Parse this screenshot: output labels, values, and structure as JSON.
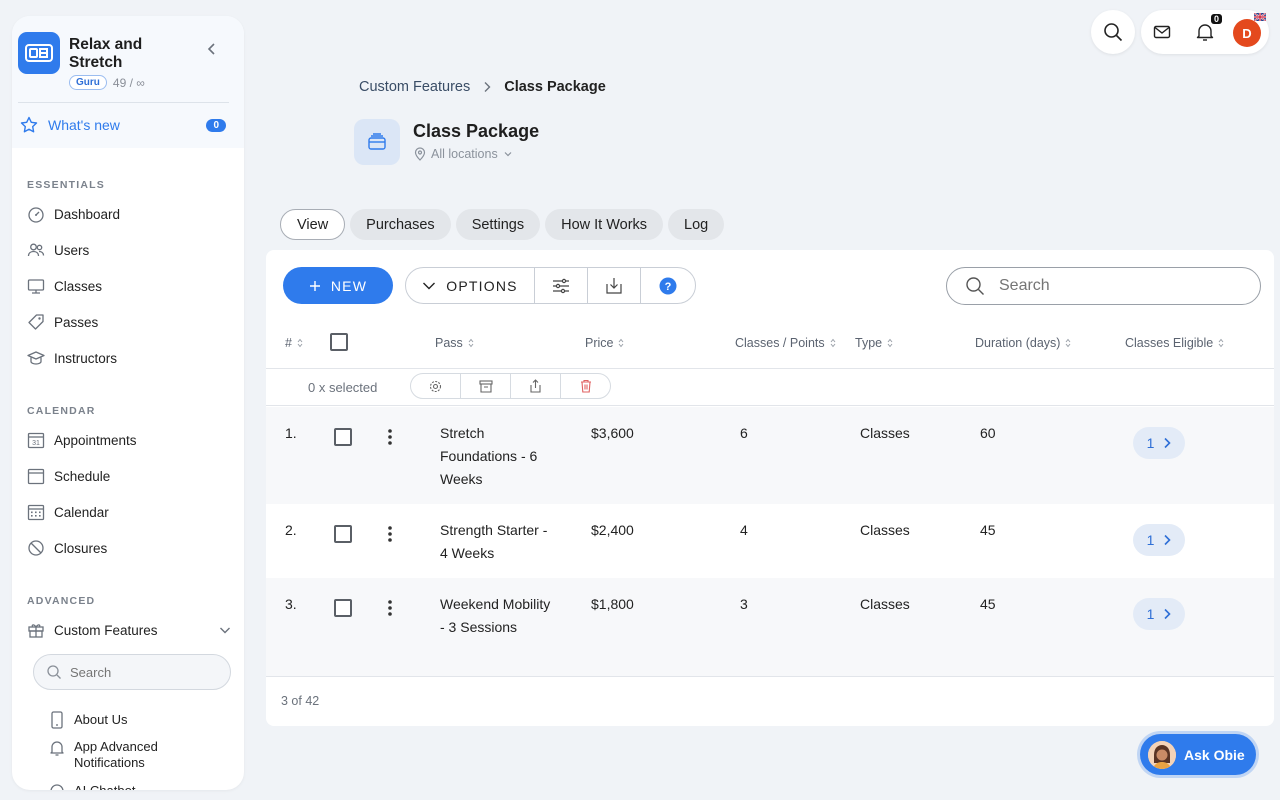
{
  "sidebar": {
    "business_name": "Relax and Stretch",
    "plan_badge": "Guru",
    "plan_count": "49 / ∞",
    "whats_new": {
      "label": "What's new",
      "count": "0"
    },
    "sections": {
      "essentials": "ESSENTIALS",
      "calendar": "CALENDAR",
      "advanced": "ADVANCED"
    },
    "essentials_items": [
      {
        "label": "Dashboard",
        "icon": "dashboard-icon"
      },
      {
        "label": "Users",
        "icon": "users-icon"
      },
      {
        "label": "Classes",
        "icon": "classes-icon"
      },
      {
        "label": "Passes",
        "icon": "passes-icon"
      },
      {
        "label": "Instructors",
        "icon": "instructors-icon"
      }
    ],
    "calendar_items": [
      {
        "label": "Appointments",
        "icon": "appointments-icon"
      },
      {
        "label": "Schedule",
        "icon": "schedule-icon"
      },
      {
        "label": "Calendar",
        "icon": "calendar-icon"
      },
      {
        "label": "Closures",
        "icon": "closures-icon"
      }
    ],
    "advanced_items": [
      {
        "label": "Custom Features",
        "icon": "gift-icon"
      }
    ],
    "search_placeholder": "Search",
    "sub_items": [
      {
        "label": "About Us",
        "icon": "phone-icon"
      },
      {
        "label": "App Advanced Notifications",
        "icon": "bell-icon"
      },
      {
        "label": "AI Chatbot",
        "icon": "chatbot-icon"
      }
    ]
  },
  "topbar": {
    "notification_count": "0",
    "avatar_initial": "D"
  },
  "header": {
    "breadcrumb": [
      "Custom Features",
      "Class Package"
    ],
    "title": "Class Package",
    "location": "All locations"
  },
  "tabs": [
    "View",
    "Purchases",
    "Settings",
    "How It Works",
    "Log"
  ],
  "toolbar": {
    "new_label": "NEW",
    "options_label": "OPTIONS",
    "search_placeholder": "Search"
  },
  "table": {
    "columns": [
      "#",
      "Pass",
      "Price",
      "Classes / Points",
      "Type",
      "Duration (days)",
      "Classes Eligible"
    ],
    "selected_text": "0 x selected",
    "rows": [
      {
        "num": "1.",
        "pass": "Stretch Foundations - 6 Weeks",
        "price": "$3,600",
        "classes": "6",
        "type": "Classes",
        "duration": "60",
        "eligible": "1"
      },
      {
        "num": "2.",
        "pass": "Strength Starter - 4 Weeks",
        "price": "$2,400",
        "classes": "4",
        "type": "Classes",
        "duration": "45",
        "eligible": "1"
      },
      {
        "num": "3.",
        "pass": "Weekend Mobility - 3 Sessions",
        "price": "$1,800",
        "classes": "3",
        "type": "Classes",
        "duration": "45",
        "eligible": "1"
      }
    ],
    "footer": "3 of 42"
  },
  "assistant": {
    "label": "Ask Obie"
  },
  "colors": {
    "accent": "#2f7bec",
    "avatar": "#e4491d",
    "background": "#f0f3f7"
  }
}
